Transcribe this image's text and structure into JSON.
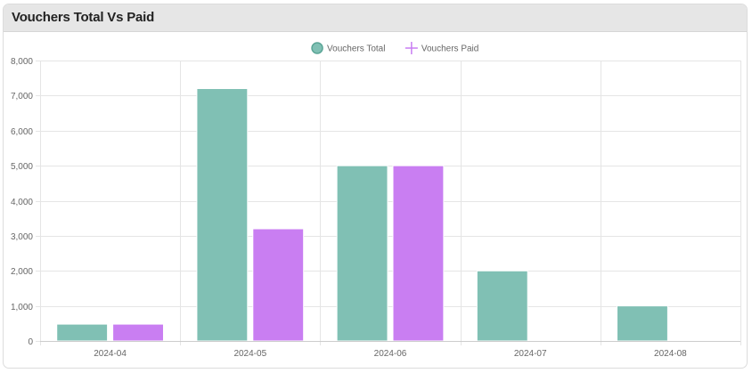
{
  "card": {
    "title": "Vouchers Total Vs Paid"
  },
  "chart_data": {
    "type": "bar",
    "title": "",
    "xlabel": "",
    "ylabel": "",
    "categories": [
      "2024-04",
      "2024-05",
      "2024-06",
      "2024-07",
      "2024-08"
    ],
    "series": [
      {
        "name": "Vouchers Total",
        "values": [
          480,
          7200,
          5000,
          2000,
          1000
        ],
        "color": "#80c0b4",
        "legend_marker": "circle"
      },
      {
        "name": "Vouchers Paid",
        "values": [
          480,
          3200,
          5000,
          0,
          0
        ],
        "color": "#c97ef2",
        "legend_marker": "cross"
      }
    ],
    "ylim": [
      0,
      8000
    ],
    "y_ticks": [
      0,
      1000,
      2000,
      3000,
      4000,
      5000,
      6000,
      7000,
      8000
    ],
    "y_tick_labels": [
      "0",
      "1,000",
      "2,000",
      "3,000",
      "4,000",
      "5,000",
      "6,000",
      "7,000",
      "8,000"
    ],
    "grid": true,
    "legend_position": "top-center"
  }
}
